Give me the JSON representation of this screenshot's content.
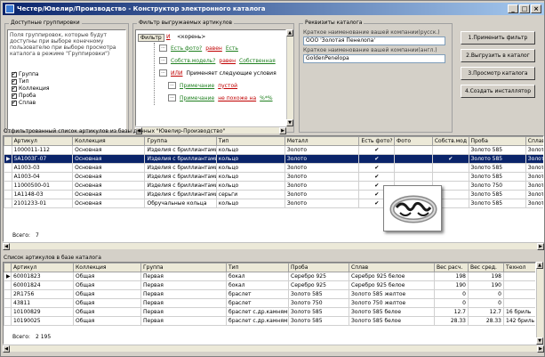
{
  "window": {
    "title": "Честер/Ювелир/Производство - Конструктор электронного каталога",
    "minimize": "_",
    "maximize": "□",
    "close": "×"
  },
  "groups": {
    "groupings_title": "Доступные группировки",
    "groupings_hint": "Поля группировок, которые будут доступны при выборе конечному пользователю при выборе просмотра каталога в режиме \"Группировки\")",
    "groupings_items": [
      {
        "label": "Группа",
        "checked": true
      },
      {
        "label": "Тип",
        "checked": true
      },
      {
        "label": "Коллекция",
        "checked": true
      },
      {
        "label": "Проба",
        "checked": true
      },
      {
        "label": "Сплав",
        "checked": true
      }
    ],
    "filter_title": "Фильтр выгружаемых артикулов",
    "filter_button": "Фильтр",
    "filter_and": "И",
    "filter_root": "<корень>",
    "filter_rows": [
      {
        "field": "Есть фото?",
        "op": "равен",
        "value": "Есть"
      },
      {
        "field": "Собств.модель?",
        "op": "равен",
        "value": "Собственная"
      },
      {
        "field": "ИЛИ",
        "op": "Применяет следующие условия",
        "value": ""
      },
      {
        "field": "Примечание",
        "op": "пустой",
        "value": ""
      },
      {
        "field": "Примечание",
        "op": "не похоже на",
        "value": "%*%"
      }
    ],
    "reqs_title": "Реквизиты каталога",
    "reqs_short_ru_label": "Краткое наименование вашей компании(русск.)",
    "reqs_short_ru_value": "ООО 'Золотая Пенелопа'",
    "reqs_short_en_label": "Краткое наименование вашей компании(англ.)",
    "reqs_short_en_value": "GoldenPenelopa"
  },
  "actions": [
    "1.Применить фильтр",
    "2.Выгрузить в каталог",
    "3.Просмотр каталога",
    "4.Создать инсталлятор"
  ],
  "filtered_grid": {
    "caption": "Отфильтрованный список артикулов из базы данных \"Ювелир-Производство\"",
    "headers": [
      "Артикул",
      "Коллекция",
      "Группа",
      "Тип",
      "Металл",
      "Есть фото?",
      "Фото",
      "Собств.мод",
      "Проба",
      "Сплав"
    ],
    "rows": [
      [
        "1000011-112",
        "Основная",
        "Изделия с бриллиантами",
        "кольцо",
        "Золото",
        "✔",
        "",
        "",
        "Золото 585",
        "Золот"
      ],
      [
        "5A1003Г-07",
        "Основная",
        "Изделия с бриллиантами",
        "кольцо",
        "Золото",
        "✔",
        "",
        "✔",
        "Золото 585",
        "Золот"
      ],
      [
        "A1003-03",
        "Основная",
        "Изделия с бриллиантами",
        "кольцо",
        "Золото",
        "✔",
        "",
        "",
        "Золото 585",
        "Золот"
      ],
      [
        "A1003-04",
        "Основная",
        "Изделия с бриллиантами",
        "кольцо",
        "Золото",
        "✔",
        "",
        "",
        "Золото 585",
        "Золот"
      ],
      [
        "11000500-01",
        "Основная",
        "Изделия с бриллиантами",
        "кольцо",
        "Золото",
        "✔",
        "",
        "",
        "Золото 750",
        "Золот"
      ],
      [
        "1A1148-03",
        "Основная",
        "Изделия с бриллиантами",
        "серьги",
        "Золото",
        "✔",
        "",
        "",
        "Золото 585",
        "Золот"
      ],
      [
        "2101233-01",
        "Основная",
        "Обручальные кольца",
        "кольцо",
        "Золото",
        "✔",
        "",
        "",
        "Золото 585",
        "Золот"
      ]
    ],
    "total_label": "Всего:",
    "total_value": "7"
  },
  "base_grid": {
    "caption": "Список артикулов в базе каталога",
    "headers": [
      "Артикул",
      "Коллекция",
      "Группа",
      "Тип",
      "Проба",
      "Сплав",
      "Вес расч.",
      "Вес сред.",
      "Технол"
    ],
    "rows": [
      [
        "60001823",
        "Общая",
        "Первая",
        "бокал",
        "Серебро 925",
        "Серебро 925 белое",
        "198",
        "198",
        ""
      ],
      [
        "60001824",
        "Общая",
        "Первая",
        "бокал",
        "Серебро 925",
        "Серебро 925 белое",
        "190",
        "190",
        ""
      ],
      [
        "2R1756",
        "Общая",
        "Первая",
        "браслет",
        "Золото 585",
        "Золото 585 желтое",
        "0",
        "0",
        ""
      ],
      [
        "43811",
        "Общая",
        "Первая",
        "браслет",
        "Золото 750",
        "Золото 750 желтое",
        "0",
        "0",
        ""
      ],
      [
        "10100829",
        "Общая",
        "Первая",
        "браслет с.др.камнями",
        "Золото 585",
        "Золото 585 белое",
        "12.7",
        "12.7",
        "16 бриль"
      ],
      [
        "10190025",
        "Общая",
        "Первая",
        "браслет с.др.камнями",
        "Золото 585",
        "Золото 585 белое",
        "28.33",
        "28.33",
        "142 бриль"
      ]
    ],
    "total_label": "Всего:",
    "total_value": "2 195"
  }
}
